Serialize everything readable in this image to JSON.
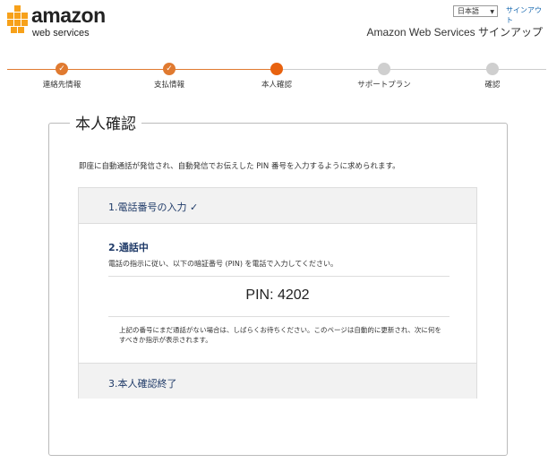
{
  "header": {
    "logo_amazon": "amazon",
    "logo_web_services": "web services",
    "language": "日本語",
    "signout": "サインアウト",
    "title": "Amazon Web Services サインアップ"
  },
  "steps": [
    {
      "label": "連絡先情報",
      "status": "done"
    },
    {
      "label": "支払情報",
      "status": "done"
    },
    {
      "label": "本人確認",
      "status": "current"
    },
    {
      "label": "サポートプラン",
      "status": "todo"
    },
    {
      "label": "確認",
      "status": "todo"
    }
  ],
  "main": {
    "title": "本人確認",
    "intro": "即座に自動通話が発信され、自動発信でお伝えした PIN 番号を入力するように求められます。",
    "section1": "1.電話番号の入力 ✓",
    "section2_title": "2.通話中",
    "section2_desc": "電話の指示に従い、以下の暗証番号 (PIN) を電話で入力してください。",
    "pin": "PIN: 4202",
    "note": "上記の番号にまだ通話がない場合は、しばらくお待ちください。このページは自動的に更新され、次に何をすべきか指示が表示されます。",
    "section3": "3.本人確認終了"
  },
  "colors": {
    "accent": "#e07a30",
    "link": "#1a6ab0",
    "section_text": "#1f3a68"
  }
}
